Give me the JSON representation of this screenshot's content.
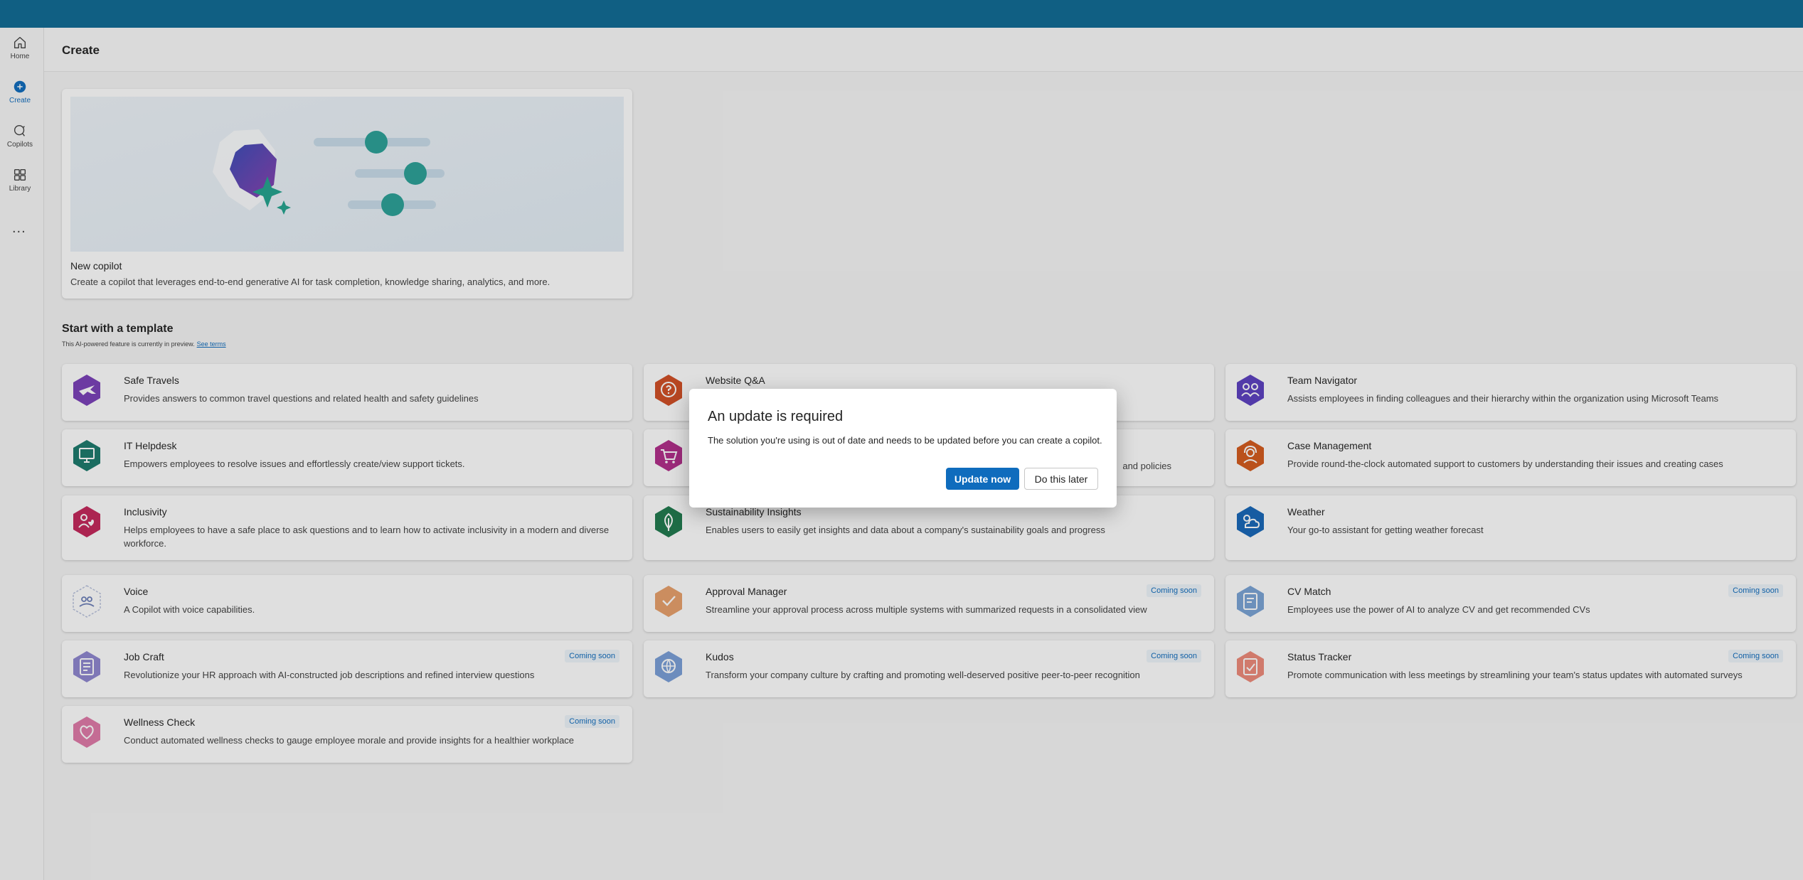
{
  "nav": {
    "items": [
      {
        "label": "Home",
        "icon": "home-icon"
      },
      {
        "label": "Create",
        "icon": "plus-circle-icon"
      },
      {
        "label": "Copilots",
        "icon": "copilot-icon"
      },
      {
        "label": "Library",
        "icon": "library-icon"
      }
    ],
    "more": "..."
  },
  "header": {
    "title": "Create"
  },
  "hero": {
    "title": "New copilot",
    "description": "Create a copilot that leverages end-to-end generative AI for task completion, knowledge sharing, analytics, and more."
  },
  "templates": {
    "title": "Start with a template",
    "preview_note": "This AI-powered feature is currently in preview.",
    "see_terms": "See terms",
    "badge_label": "Coming soon",
    "cards": [
      {
        "title": "Safe Travels",
        "desc": "Provides answers to common travel questions and related health and safety guidelines",
        "icon": "airplane-icon",
        "color": "#7a3fb8",
        "soon": false
      },
      {
        "title": "Website Q&A",
        "desc": "",
        "icon": "chat-question-icon",
        "color": "#d14d24",
        "soon": false
      },
      {
        "title": "Team Navigator",
        "desc": "Assists employees in finding colleagues and their hierarchy within the organization using Microsoft Teams",
        "icon": "people-team-icon",
        "color": "#5b3fc0",
        "soon": false
      },
      {
        "title": "IT Helpdesk",
        "desc": "Empowers employees to resolve issues and effortlessly create/view support tickets.",
        "icon": "desktop-icon",
        "color": "#1a7a6c",
        "soon": false
      },
      {
        "title": "",
        "desc": "and policies",
        "icon": "cart-icon",
        "color": "#b12d8a",
        "soon": false
      },
      {
        "title": "Case Management",
        "desc": "Provide round-the-clock automated support to customers by understanding their issues and creating cases",
        "icon": "person-support-icon",
        "color": "#d45a1c",
        "soon": false
      },
      {
        "title": "Inclusivity",
        "desc": "Helps employees to have a safe place to ask questions and to learn how to activate inclusivity in a modern and diverse workforce.",
        "icon": "people-heart-icon",
        "color": "#c4265a",
        "soon": false
      },
      {
        "title": "Sustainability Insights",
        "desc": "Enables users to easily get insights and data about a company's sustainability goals and progress",
        "icon": "leaf-icon",
        "color": "#1f7a4d",
        "soon": false
      },
      {
        "title": "Weather",
        "desc": "Your go-to assistant for getting weather forecast",
        "icon": "weather-icon",
        "color": "#1767b8",
        "soon": false
      },
      {
        "title": "Voice",
        "desc": "A Copilot with voice capabilities.",
        "icon": "voice-people-icon",
        "color": "#6d7fb8",
        "soon": false
      },
      {
        "title": "Approval Manager",
        "desc": "Streamline your approval process across multiple systems with summarized requests in a consolidated view",
        "icon": "approval-icon",
        "color": "#e8a06a",
        "soon": true
      },
      {
        "title": "CV Match",
        "desc": "Employees use the power of AI to analyze CV and get recommended CVs",
        "icon": "document-person-icon",
        "color": "#7aa3d6",
        "soon": true
      },
      {
        "title": "Job Craft",
        "desc": "Revolutionize your HR approach with AI-constructed job descriptions and refined interview questions",
        "icon": "document-edit-icon",
        "color": "#8f86d0",
        "soon": true
      },
      {
        "title": "Kudos",
        "desc": "Transform your company culture by crafting and promoting well-deserved positive peer-to-peer recognition",
        "icon": "globe-hands-icon",
        "color": "#7a9fd8",
        "soon": true
      },
      {
        "title": "Status Tracker",
        "desc": "Promote communication with less meetings by streamlining your team's status updates with automated surveys",
        "icon": "document-check-icon",
        "color": "#ee8a7a",
        "soon": true
      },
      {
        "title": "Wellness Check",
        "desc": "Conduct automated wellness checks to gauge employee morale and provide insights for a healthier workplace",
        "icon": "wellness-icon",
        "color": "#e07aa8",
        "soon": true
      }
    ]
  },
  "dialog": {
    "title": "An update is required",
    "body": "The solution you're using is out of date and needs to be updated before you can create a copilot.",
    "primary": "Update now",
    "secondary": "Do this later"
  }
}
